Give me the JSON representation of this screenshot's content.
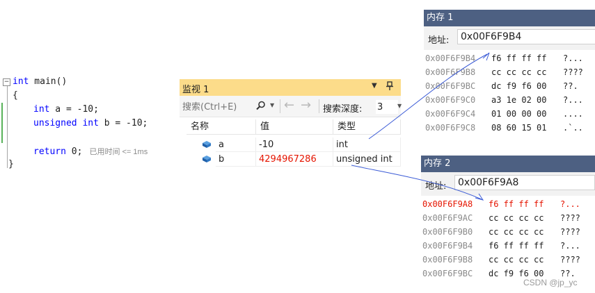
{
  "editor": {
    "fold_glyph": "−",
    "lines": [
      {
        "kw": "int",
        "text": " main()"
      },
      {
        "text": "{"
      },
      {
        "kw": "int",
        "text": " a = -10;"
      },
      {
        "kw": "unsigned int",
        "text": " b = -10;"
      },
      {
        "text": ""
      },
      {
        "kw": "return",
        "text": " 0;",
        "hint": "已用时间 <= 1ms"
      },
      {
        "text": "}"
      }
    ]
  },
  "watch": {
    "title": "监视 1",
    "search_placeholder": "搜索(Ctrl+E)",
    "depth_label": "搜索深度:",
    "depth_value": "3",
    "columns": [
      "名称",
      "值",
      "类型"
    ],
    "rows": [
      {
        "name": "a",
        "value": "-10",
        "type": "int",
        "changed": false
      },
      {
        "name": "b",
        "value": "4294967286",
        "type": "unsigned int",
        "changed": true
      }
    ]
  },
  "memory1": {
    "title": "内存 1",
    "address_label": "地址:",
    "address_value": "0x00F6F9B4",
    "rows": [
      {
        "addr": "0x00F6F9B4",
        "bytes": "f6 ff ff ff",
        "chars": "?...",
        "highlight": false
      },
      {
        "addr": "0x00F6F9B8",
        "bytes": "cc cc cc cc",
        "chars": "????",
        "highlight": false
      },
      {
        "addr": "0x00F6F9BC",
        "bytes": "dc f9 f6 00",
        "chars": "??.",
        "highlight": false
      },
      {
        "addr": "0x00F6F9C0",
        "bytes": "a3 1e 02 00",
        "chars": "?...",
        "highlight": false
      },
      {
        "addr": "0x00F6F9C4",
        "bytes": "01 00 00 00",
        "chars": "....",
        "highlight": false
      },
      {
        "addr": "0x00F6F9C8",
        "bytes": "08 60 15 01",
        "chars": ".`..",
        "highlight": false
      }
    ]
  },
  "memory2": {
    "title": "内存 2",
    "address_label": "地址:",
    "address_value": "0x00F6F9A8",
    "rows": [
      {
        "addr": "0x00F6F9A8",
        "bytes": "f6 ff ff ff",
        "chars": "?...",
        "highlight": true
      },
      {
        "addr": "0x00F6F9AC",
        "bytes": "cc cc cc cc",
        "chars": "????",
        "highlight": false
      },
      {
        "addr": "0x00F6F9B0",
        "bytes": "cc cc cc cc",
        "chars": "????",
        "highlight": false
      },
      {
        "addr": "0x00F6F9B4",
        "bytes": "f6 ff ff ff",
        "chars": "?...",
        "highlight": false
      },
      {
        "addr": "0x00F6F9B8",
        "bytes": "cc cc cc cc",
        "chars": "????",
        "highlight": false
      },
      {
        "addr": "0x00F6F9BC",
        "bytes": "dc f9 f6 00",
        "chars": "??.",
        "highlight": false
      }
    ]
  },
  "watermark": "CSDN @jp_yc",
  "colors": {
    "watch_title_bg": "#fcdc8a",
    "memory_title_bg": "#4d6082",
    "changed_value": "#e51400",
    "keyword": "#0000ff",
    "annotation_arrow": "#3b5bd6"
  },
  "icons": [
    "collapse-minus-icon",
    "search-icon",
    "dropdown-icon",
    "pin-icon",
    "back-arrow-icon",
    "forward-arrow-icon",
    "variable-cube-icon"
  ]
}
